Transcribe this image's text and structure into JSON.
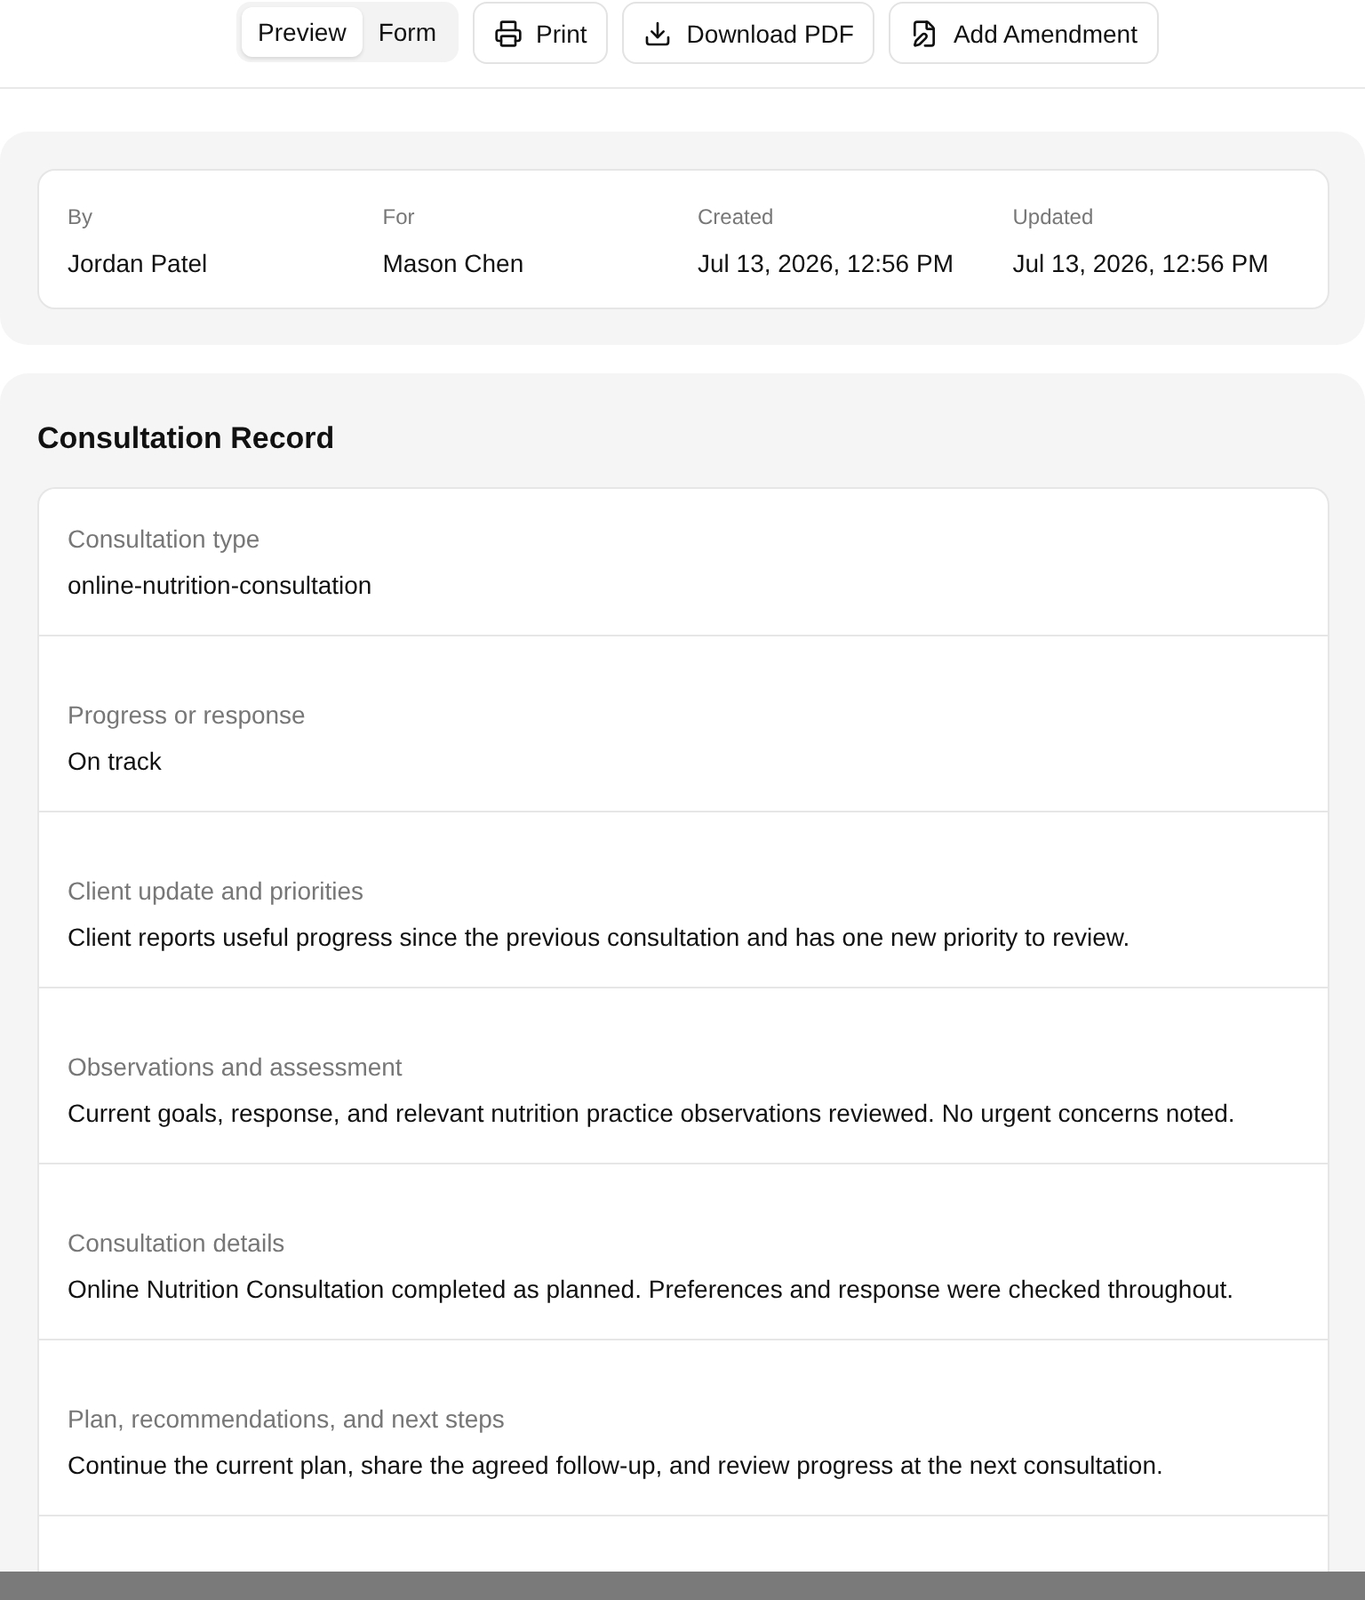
{
  "toolbar": {
    "view_tabs": [
      {
        "label": "Preview",
        "selected": true
      },
      {
        "label": "Form",
        "selected": false
      }
    ],
    "actions": [
      {
        "kind": "print",
        "label": "Print"
      },
      {
        "kind": "download",
        "label": "Download PDF"
      },
      {
        "kind": "amend",
        "label": "Add Amendment"
      }
    ]
  },
  "meta": [
    {
      "label": "By",
      "value": "Jordan Patel"
    },
    {
      "label": "For",
      "value": "Mason Chen"
    },
    {
      "label": "Created",
      "value": "Jul 13, 2026, 12:56 PM"
    },
    {
      "label": "Updated",
      "value": "Jul 13, 2026, 12:56 PM"
    }
  ],
  "record": {
    "title": "Consultation Record",
    "fields": [
      {
        "label": "Consultation type",
        "value": "online-nutrition-consultation"
      },
      {
        "label": "Progress or response",
        "value": "On track"
      },
      {
        "label": "Client update and priorities",
        "value": "Client reports useful progress since the previous consultation and has one new priority to review."
      },
      {
        "label": "Observations and assessment",
        "value": "Current goals, response, and relevant nutrition practice observations reviewed. No urgent concerns noted."
      },
      {
        "label": "Consultation details",
        "value": "Online Nutrition Consultation completed as planned. Preferences and response were checked throughout."
      },
      {
        "label": "Plan, recommendations, and next steps",
        "value": "Continue the current plan, share the agreed follow-up, and review progress at the next consultation."
      }
    ]
  }
}
